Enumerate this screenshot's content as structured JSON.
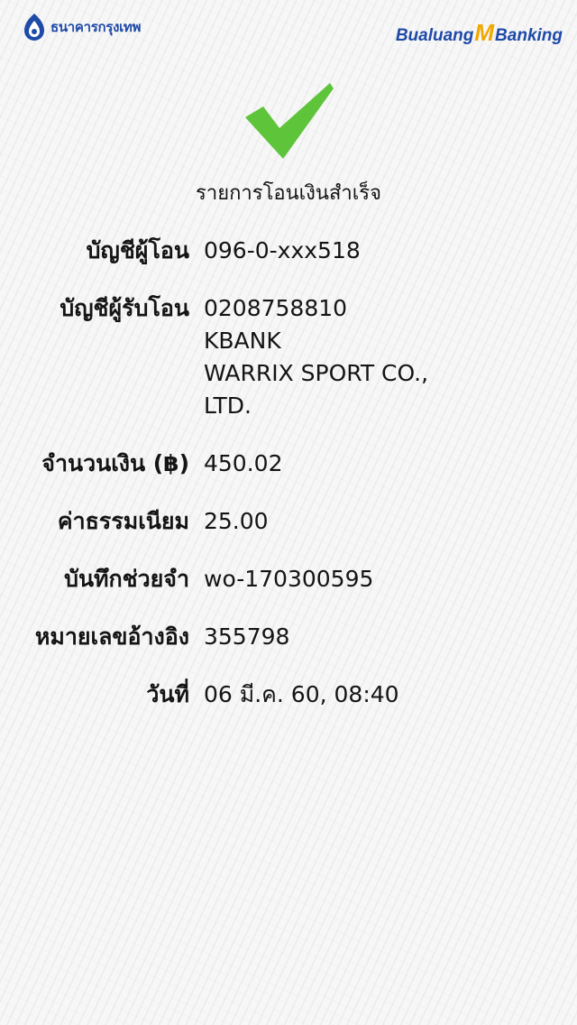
{
  "header": {
    "bank_name": "ธนาคารกรุงเทพ",
    "app_brand_part1": "Bualuang",
    "app_brand_m": "M",
    "app_brand_part2": "Banking",
    "brand_color": "#1e4aa8",
    "accent_color": "#f0a800"
  },
  "status": {
    "icon": "checkmark-icon",
    "icon_color": "#5ec43a",
    "title": "รายการโอนเงินสำเร็จ"
  },
  "details": {
    "from_account": {
      "label": "บัญชีผู้โอน",
      "value": "096-0-xxx518"
    },
    "to_account": {
      "label": "บัญชีผู้รับโอน",
      "account_number": "0208758810",
      "bank": "KBANK",
      "name_line1": "WARRIX SPORT CO.,",
      "name_line2": "LTD."
    },
    "amount": {
      "label": "จำนวนเงิน (฿)",
      "value": "450.02"
    },
    "fee": {
      "label": "ค่าธรรมเนียม",
      "value": "25.00"
    },
    "memo": {
      "label": "บันทึกช่วยจำ",
      "value": "wo-170300595"
    },
    "reference": {
      "label": "หมายเลขอ้างอิง",
      "value": "355798"
    },
    "date": {
      "label": "วันที่",
      "value": "06 มี.ค. 60, 08:40"
    }
  }
}
